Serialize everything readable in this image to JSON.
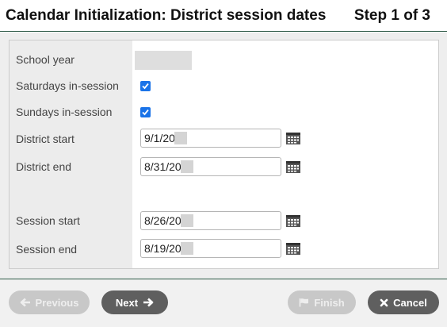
{
  "header": {
    "title": "Calendar Initialization: District session dates",
    "step": "Step 1 of 3"
  },
  "form": {
    "school_year": {
      "label": "School year",
      "value": ""
    },
    "saturdays": {
      "label": "Saturdays in-session",
      "checked": true
    },
    "sundays": {
      "label": "Sundays in-session",
      "checked": true
    },
    "district_start": {
      "label": "District start",
      "value": "9/1/20"
    },
    "district_end": {
      "label": "District end",
      "value": "8/31/20"
    },
    "session_start": {
      "label": "Session start",
      "value": "8/26/20"
    },
    "session_end": {
      "label": "Session end",
      "value": "8/19/20"
    }
  },
  "footer": {
    "previous_label": "Previous",
    "next_label": "Next",
    "finish_label": "Finish",
    "cancel_label": "Cancel"
  },
  "colors": {
    "accent_line": "#2e5a47",
    "checkbox": "#1a73e8",
    "button_active": "#5f5f5f",
    "button_disabled": "#c8c8c8"
  },
  "icons": [
    "calendar-icon",
    "arrow-left-icon",
    "arrow-right-icon",
    "flag-icon",
    "close-icon",
    "checkmark-icon"
  ]
}
